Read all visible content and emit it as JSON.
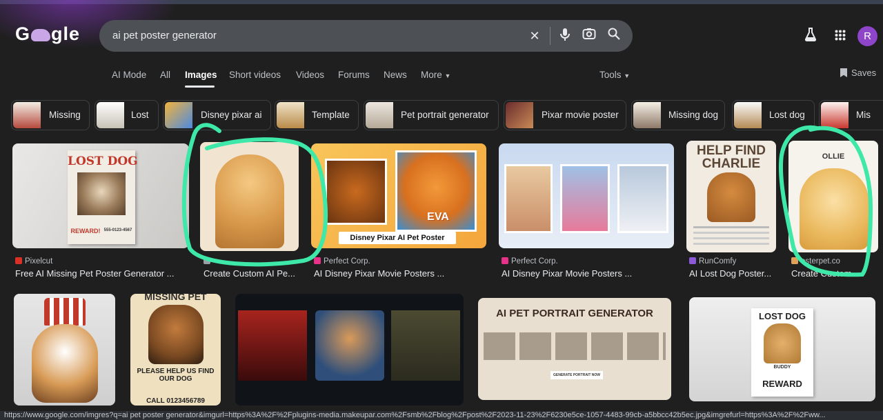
{
  "logo": {
    "text_left": "G",
    "text_right": "gle"
  },
  "search": {
    "query": "ai pet poster generator"
  },
  "header_icons": {
    "labs": "flask-icon",
    "apps": "apps-grid-icon",
    "avatar": "R"
  },
  "tabs": [
    {
      "label": "AI Mode"
    },
    {
      "label": "All"
    },
    {
      "label": "Images"
    },
    {
      "label": "Short videos"
    },
    {
      "label": "Videos"
    },
    {
      "label": "Forums"
    },
    {
      "label": "News"
    },
    {
      "label": "More"
    }
  ],
  "tools_label": "Tools",
  "saves_label": "Saves",
  "chips": [
    {
      "label": "Missing"
    },
    {
      "label": "Lost"
    },
    {
      "label": "Disney pixar ai"
    },
    {
      "label": "Template"
    },
    {
      "label": "Pet portrait generator"
    },
    {
      "label": "Pixar movie poster"
    },
    {
      "label": "Missing dog"
    },
    {
      "label": "Lost dog"
    },
    {
      "label": "Mis"
    }
  ],
  "results_row1": [
    {
      "source": "Pixelcut",
      "title": "Free AI Missing Pet Poster Generator ...",
      "poster": {
        "head": "LOST DOG",
        "reward": "REWARD!",
        "phone": "555-0123-4567"
      },
      "fav_color": "#d93025"
    },
    {
      "source": "",
      "title": "Create Custom AI Pe...",
      "fav_color": "#9aa0a6"
    },
    {
      "source": "Perfect Corp.",
      "title": "AI Disney Pixar Movie Posters ...",
      "poster": {
        "name": "EVA",
        "banner": "Disney Pixar AI Pet Poster"
      },
      "fav_color": "#e8328a"
    },
    {
      "source": "Perfect Corp.",
      "title": "AI Disney Pixar Movie Posters ...",
      "fav_color": "#e8328a"
    },
    {
      "source": "RunComfy",
      "title": "AI Lost Dog Poster...",
      "poster": {
        "head1": "HELP FIND",
        "head2": "CHARLIE"
      },
      "fav_color": "#8c59d9"
    },
    {
      "source": "osterpet.co",
      "title": "Create Custom ...",
      "poster": {
        "name": "OLLIE"
      },
      "fav_color": "#e0a25a"
    }
  ],
  "results_row2": [
    {
      "poster": {}
    },
    {
      "poster": {
        "head": "MISSING PET",
        "line1": "PLEASE HELP US FIND",
        "line2": "OUR DOG",
        "call": "CALL 0123456789"
      }
    },
    {
      "poster": {}
    },
    {
      "poster": {
        "head": "AI PET PORTRAIT GENERATOR",
        "button": "GENERATE PORTRAIT NOW"
      }
    },
    {
      "poster": {
        "head": "LOST DOG",
        "name": "BUDDY",
        "reward": "REWARD"
      }
    }
  ],
  "status_url": "https://www.google.com/imgres?q=ai pet poster generator&imgurl=https%3A%2F%2Fplugins-media.makeupar.com%2Fsmb%2Fblog%2Fpost%2F2023-11-23%2F6230e5ce-1057-4483-99cb-a5bbcc42b5ec.jpg&imgrefurl=https%3A%2F%2Fww...",
  "colors": {
    "background": "#1f1f1f",
    "search_bg": "#4d5156",
    "annotation": "#3ee8a8",
    "avatar": "#8e45c9"
  }
}
